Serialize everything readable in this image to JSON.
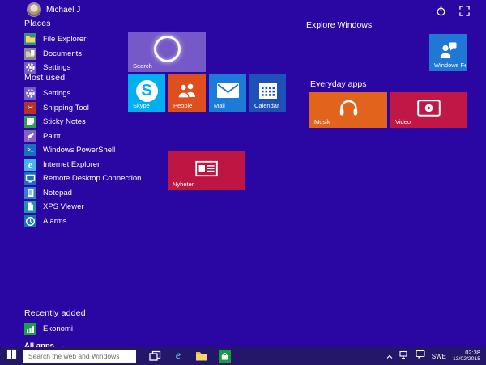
{
  "screen": {
    "background": "#2a07a3",
    "taskbar_background": "#241668"
  },
  "header": {
    "user_name": "Michael J",
    "actions": [
      "power-icon",
      "expand-icon"
    ]
  },
  "sidebar": {
    "places": {
      "title": "Places",
      "items": [
        {
          "label": "File Explorer",
          "icon": "folder",
          "color": "#3e8f7a"
        },
        {
          "label": "Documents",
          "icon": "documents-folder",
          "color": "#8a8894"
        },
        {
          "label": "Settings",
          "icon": "gear",
          "color": "#7659c8"
        }
      ]
    },
    "most_used": {
      "title": "Most used",
      "items": [
        {
          "label": "Settings",
          "icon": "gear",
          "color": "#7659c8"
        },
        {
          "label": "Snipping Tool",
          "icon": "scissors",
          "color": "#b5342a",
          "glyph": "✂"
        },
        {
          "label": "Sticky Notes",
          "icon": "note",
          "color": "#2e9e4f"
        },
        {
          "label": "Paint",
          "icon": "paint-brush",
          "color": "#8a5cc8"
        },
        {
          "label": "Windows PowerShell",
          "icon": "powershell-prompt",
          "color": "#1a6fc4",
          "glyph": ">_"
        },
        {
          "label": "Internet Explorer",
          "icon": "ie-e",
          "color": "#45b6ea",
          "glyph": "e"
        },
        {
          "label": "Remote Desktop Connection",
          "icon": "monitor",
          "color": "#1a6fc4"
        },
        {
          "label": "Notepad",
          "icon": "notepad-page",
          "color": "#2f80d0"
        },
        {
          "label": "XPS Viewer",
          "icon": "xps-page",
          "color": "#1d97a4"
        },
        {
          "label": "Alarms",
          "icon": "clock",
          "color": "#1a6fc4"
        }
      ]
    },
    "recently_added": {
      "title": "Recently added",
      "items": [
        {
          "label": "Ekonomi",
          "icon": "bar-chart",
          "color": "#1f9e4b"
        }
      ]
    },
    "all_apps": {
      "label": "All apps",
      "arrow": "→"
    }
  },
  "groups": {
    "explore": {
      "title": "Explore Windows"
    },
    "everyday": {
      "title": "Everyday apps"
    }
  },
  "tiles": {
    "search": {
      "label": "Search",
      "color": "#7659c8"
    },
    "skype": {
      "label": "Skype",
      "color": "#00aff0",
      "glyph": "S"
    },
    "people": {
      "label": "People",
      "color": "#df4e1d"
    },
    "mail": {
      "label": "Mail",
      "color": "#1d7bd8"
    },
    "calendar": {
      "label": "Calendar",
      "color": "#1e51b8"
    },
    "nyheter": {
      "label": "Nyheter",
      "color": "#bf1543"
    },
    "windows_feedback": {
      "label": "Windows Feedback",
      "color": "#2077d4"
    },
    "musik": {
      "label": "Musik",
      "color": "#e2641c"
    },
    "video": {
      "label": "Video",
      "color": "#c11746"
    }
  },
  "taskbar": {
    "search_placeholder": "Search the web and Windows",
    "icons": [
      "task-view",
      "internet-explorer",
      "file-explorer",
      "store"
    ],
    "tray": {
      "icons": [
        "hidden-icons-chevron",
        "network",
        "action-center"
      ],
      "language": "SWE",
      "time": "02:38",
      "date": "13/02/2015"
    }
  }
}
